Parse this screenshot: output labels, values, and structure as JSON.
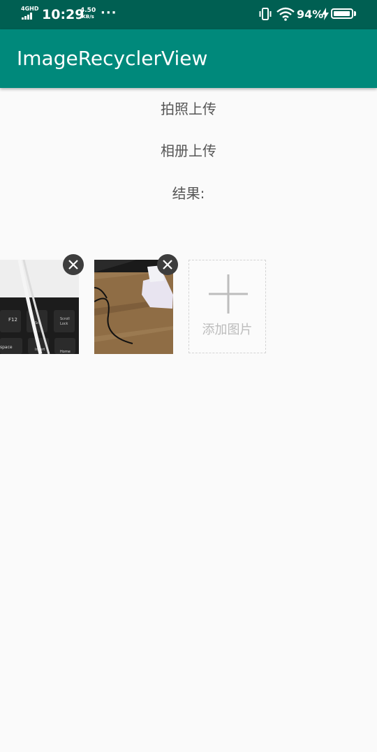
{
  "status_bar": {
    "network": "4GHD",
    "time": "10:29",
    "speed_value": "4.50",
    "speed_unit": "KB/s",
    "more": "···",
    "battery_percent": "94%",
    "battery_level": 0.94
  },
  "app_bar": {
    "title": "ImageRecyclerView",
    "color": "#00897b",
    "status_color": "#005f52"
  },
  "main": {
    "take_photo_label": "拍照上传",
    "album_upload_label": "相册上传",
    "result_label": "结果:"
  },
  "images": {
    "items": [
      {
        "name": "keyboard-photo",
        "delete_icon": "close-icon"
      },
      {
        "name": "desk-cable-photo",
        "delete_icon": "close-icon"
      }
    ],
    "add_tile": {
      "icon": "plus-icon",
      "label": "添加图片"
    }
  }
}
